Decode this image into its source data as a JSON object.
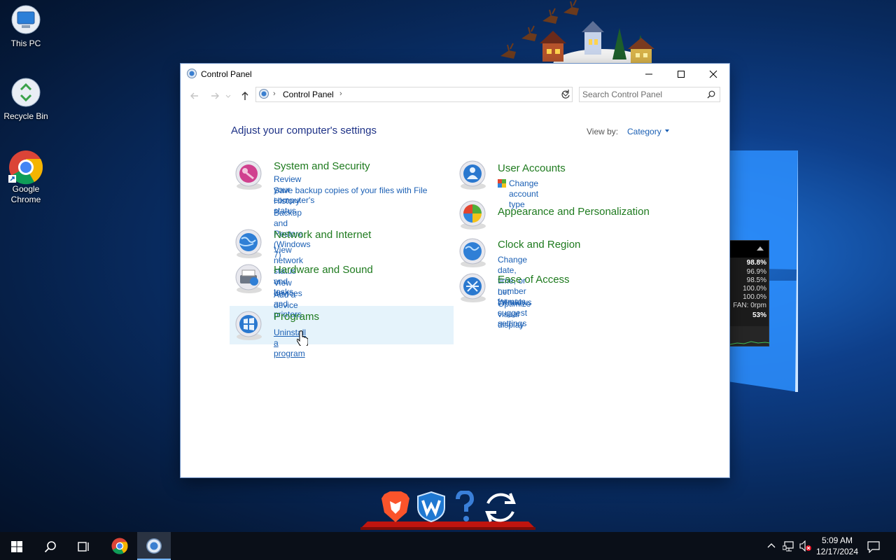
{
  "desktop": {
    "icons": [
      {
        "label": "This PC"
      },
      {
        "label": "Recycle Bin"
      },
      {
        "label": "Google Chrome"
      }
    ],
    "gadget": {
      "rows": [
        "98.8%",
        "96.9%",
        "98.5%",
        "100.0%",
        "100.0%",
        "FAN: 0rpm",
        "53%"
      ]
    }
  },
  "window": {
    "title": "Control Panel",
    "address": {
      "breadcrumb": "Control Panel"
    },
    "search": {
      "placeholder": "Search Control Panel"
    },
    "heading": "Adjust your computer's settings",
    "view_by": {
      "label": "View by:",
      "value": "Category"
    },
    "categories_left": [
      {
        "title": "System and Security",
        "icon": "shield-key-icon",
        "links": [
          "Review your computer's status",
          "Save backup copies of your files with File History",
          "Backup and Restore (Windows 7)"
        ]
      },
      {
        "title": "Network and Internet",
        "icon": "globe-network-icon",
        "links": [
          "View network status and tasks"
        ]
      },
      {
        "title": "Hardware and Sound",
        "icon": "printer-speaker-icon",
        "links": [
          "View devices and printers",
          "Add a device"
        ]
      },
      {
        "title": "Programs",
        "icon": "programs-disc-icon",
        "links": [
          "Uninstall a program"
        ]
      }
    ],
    "categories_right": [
      {
        "title": "User Accounts",
        "icon": "user-accounts-icon",
        "links": [
          "Change account type"
        ]
      },
      {
        "title": "Appearance and Personalization",
        "icon": "appearance-icon",
        "links": []
      },
      {
        "title": "Clock and Region",
        "icon": "clock-globe-icon",
        "links": [
          "Change date, time, or number formats"
        ]
      },
      {
        "title": "Ease of Access",
        "icon": "ease-of-access-icon",
        "links": [
          "Let Windows suggest settings",
          "Optimize visual display"
        ]
      }
    ]
  },
  "dock": {
    "items": [
      "brave-icon",
      "wise-care-icon",
      "help-icon",
      "sync-icon"
    ]
  },
  "taskbar": {
    "clock": {
      "time": "5:09 AM",
      "date": "12/17/2024"
    }
  },
  "colors": {
    "link": "#1a5fb4",
    "category_title": "#1e7a1e",
    "heading": "#1e3287"
  }
}
